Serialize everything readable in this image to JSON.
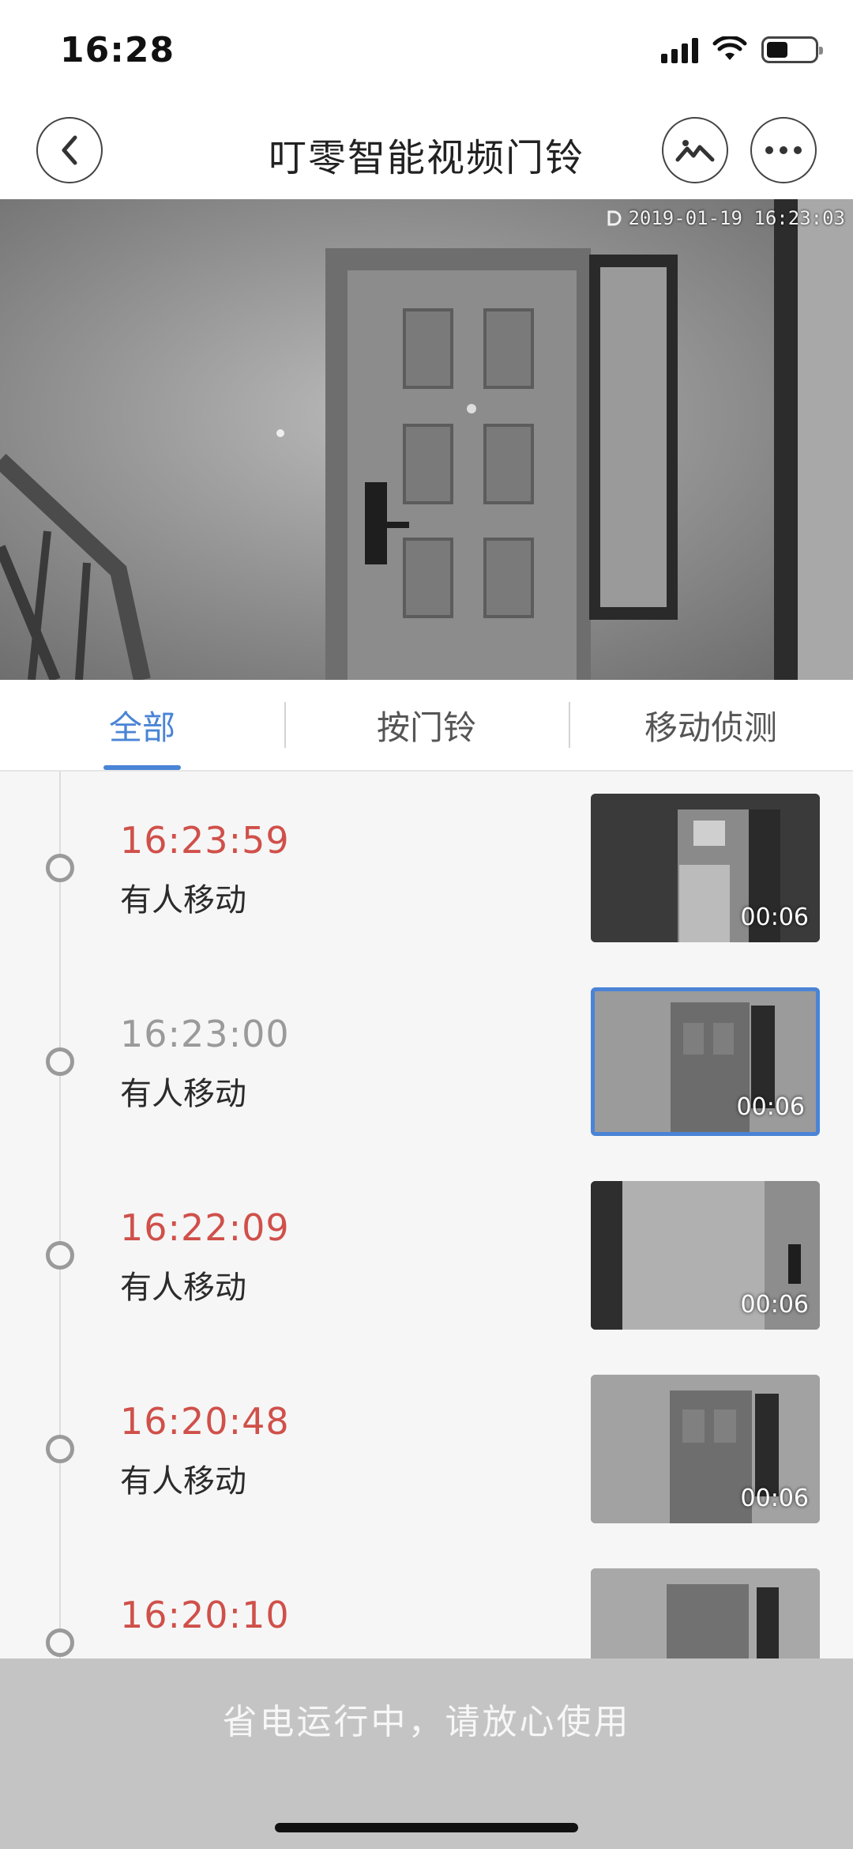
{
  "status_bar": {
    "time": "16:28",
    "icons": [
      "signal-icon",
      "wifi-icon",
      "battery-icon"
    ],
    "battery_level": 0.45
  },
  "nav": {
    "title": "叮零智能视频门铃",
    "back_icon": "chevron-left-icon",
    "gallery_icon": "image-gallery-icon",
    "more_icon": "more-dots-icon"
  },
  "live_video": {
    "timestamp": "2019-01-19 16:23:03"
  },
  "tabs": [
    {
      "label": "全部",
      "active": true
    },
    {
      "label": "按门铃",
      "active": false
    },
    {
      "label": "移动侦测",
      "active": false
    }
  ],
  "events": [
    {
      "time": "16:23:59",
      "label": "有人移动",
      "duration": "00:06"
    },
    {
      "time": "16:23:00",
      "label": "有人移动",
      "duration": "00:06"
    },
    {
      "time": "16:22:09",
      "label": "有人移动",
      "duration": "00:06"
    },
    {
      "time": "16:20:48",
      "label": "有人移动",
      "duration": "00:06"
    },
    {
      "time": "16:20:10",
      "label": "",
      "duration": ""
    }
  ],
  "banner": {
    "text": "省电运行中，请放心使用"
  },
  "colors": {
    "accent": "#4a84d6",
    "unread_time": "#d0504a",
    "read_time": "#9a9a9a",
    "banner_bg": "#c4c4c4"
  }
}
